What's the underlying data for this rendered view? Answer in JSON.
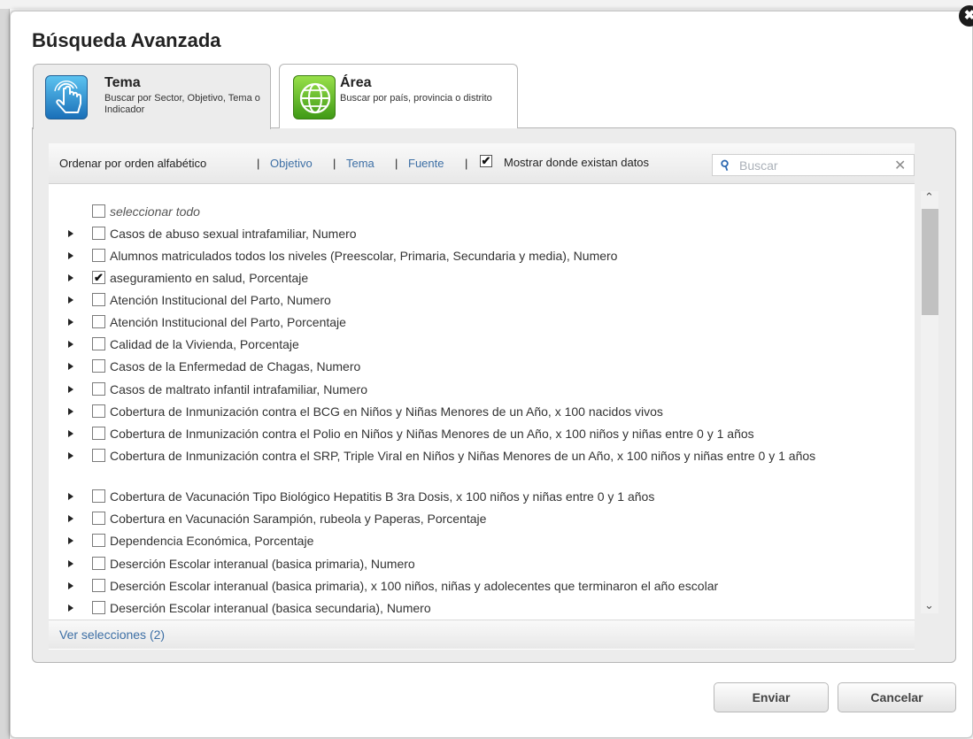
{
  "dialog": {
    "title": "Búsqueda Avanzada",
    "close_icon": "✖"
  },
  "tabs": [
    {
      "title": "Tema",
      "description": "Buscar por Sector, Objetivo, Tema o Indicador",
      "icon": "touch-hand-icon",
      "active": true
    },
    {
      "title": "Área",
      "description": "Buscar por país, provincia o distrito",
      "icon": "globe-icon",
      "active": false
    }
  ],
  "filterbar": {
    "sort_label": "Ordenar por orden alfabético",
    "separator": "|",
    "sort_options": [
      "Objetivo",
      "Tema",
      "Fuente"
    ],
    "show_data_label": "Mostrar donde existan datos",
    "show_data_checked": "✔",
    "search_placeholder": "Buscar",
    "search_icon": "⚲",
    "clear_icon": "✕"
  },
  "list": {
    "select_all_label": "seleccionar todo",
    "items": [
      {
        "label": " Casos de abuso sexual intrafamiliar, Numero",
        "checked": ""
      },
      {
        "label": "Alumnos matriculados todos los niveles (Preescolar, Primaria, Secundaria y media), Numero",
        "checked": ""
      },
      {
        "label": "aseguramiento en salud, Porcentaje",
        "checked": "✔"
      },
      {
        "label": "Atención Institucional del Parto, Numero",
        "checked": ""
      },
      {
        "label": "Atención Institucional del Parto, Porcentaje",
        "checked": ""
      },
      {
        "label": "Calidad de la Vivienda, Porcentaje",
        "checked": ""
      },
      {
        "label": "Casos de la Enfermedad de Chagas, Numero",
        "checked": ""
      },
      {
        "label": "Casos de maltrato infantil intrafamiliar, Numero",
        "checked": ""
      },
      {
        "label": "Cobertura de Inmunización contra el BCG en Niños y Niñas Menores de un Año, x 100 nacidos vivos",
        "checked": ""
      },
      {
        "label": "Cobertura de Inmunización contra el Polio en Niños y Niñas Menores de un Año, x 100 niños y niñas entre 0 y 1 años",
        "checked": ""
      },
      {
        "label": "Cobertura de Inmunización contra el SRP, Triple Viral en Niños y Niñas Menores de un Año, x 100 niños y niñas entre 0 y 1 años",
        "checked": ""
      },
      {
        "label": "Cobertura de Vacunación Tipo Biológico Hepatitis B 3ra Dosis, x 100 niños y niñas entre 0 y 1 años",
        "checked": ""
      },
      {
        "label": "Cobertura en Vacunación Sarampión, rubeola y Paperas, Porcentaje",
        "checked": ""
      },
      {
        "label": "Dependencia Económica, Porcentaje",
        "checked": ""
      },
      {
        "label": "Deserción Escolar interanual (basica primaria), Numero",
        "checked": ""
      },
      {
        "label": "Deserción Escolar interanual (basica primaria), x 100 niños, niñas y adolecentes que terminaron el año escolar",
        "checked": ""
      },
      {
        "label": "Deserción Escolar interanual (basica secundaria), Numero",
        "checked": ""
      }
    ]
  },
  "scrollbar": {
    "up_icon": "⌃",
    "down_icon": "⌄"
  },
  "footer": {
    "view_selections": "Ver selecciones (2)"
  },
  "buttons": {
    "send": "Enviar",
    "cancel": "Cancelar"
  }
}
